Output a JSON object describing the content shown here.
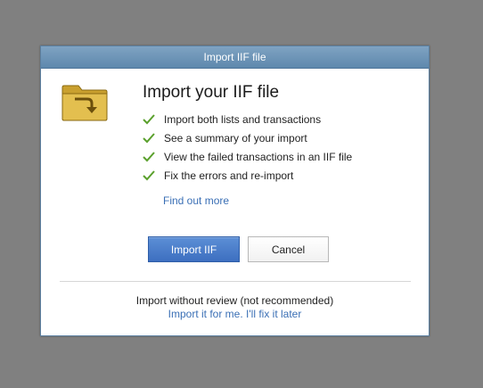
{
  "dialog": {
    "title": "Import IIF file",
    "icon": "folder-arrow-icon",
    "heading": "Import your IIF file",
    "features": [
      "Import both lists and transactions",
      "See a summary of your import",
      "View the failed transactions in an IIF file",
      "Fix the errors and re-import"
    ],
    "find_out_more": "Find out more",
    "buttons": {
      "primary": "Import IIF",
      "secondary": "Cancel"
    },
    "no_review": {
      "text": "Import without review (not recommended)",
      "link": "Import it for me. I'll fix it later"
    }
  },
  "colors": {
    "backdrop": "#808080",
    "titlebar": "#6a93b7",
    "primary_button": "#4a7dcb",
    "link": "#3a6fb5",
    "check": "#5aa02c",
    "folder": "#d9b23a"
  }
}
